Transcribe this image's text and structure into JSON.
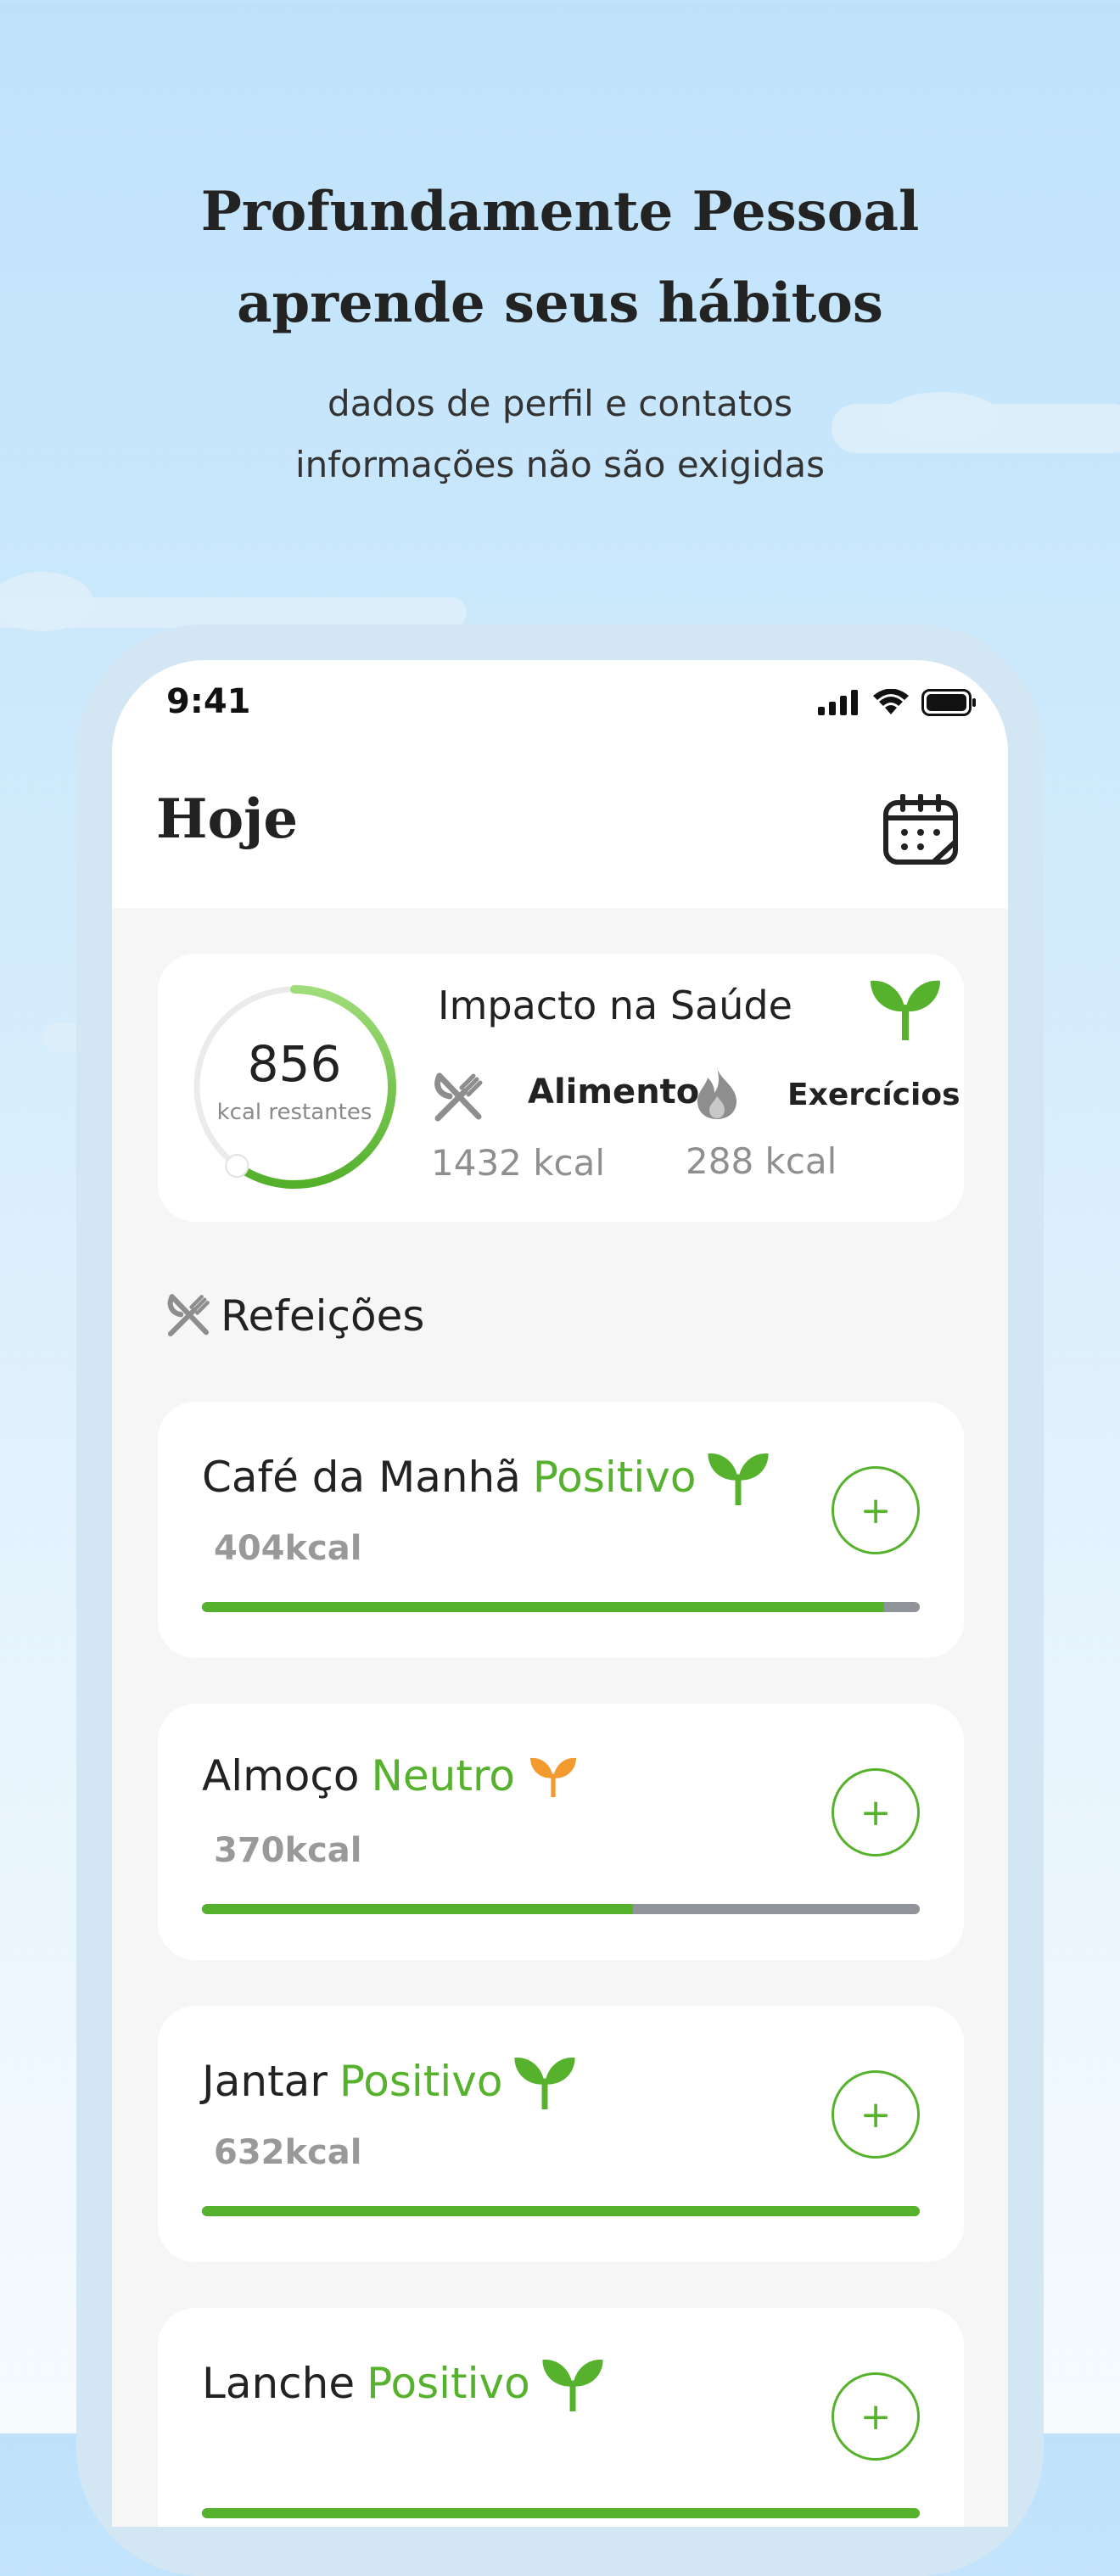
{
  "hero": {
    "title_line1": "Profundamente Pessoal",
    "title_line2": "aprende seus hábitos",
    "subtitle_line1": "dados de perfil e contatos",
    "subtitle_line2": "informações não são exigidas"
  },
  "status_bar": {
    "time": "9:41",
    "icons": [
      "signal-icon",
      "wifi-icon",
      "battery-icon"
    ]
  },
  "header": {
    "title": "Hoje",
    "calendar_icon": "calendar-icon"
  },
  "summary": {
    "remaining_value": "856",
    "remaining_label": "kcal restantes",
    "ring_progress": 0.6,
    "impact_title": "Impacto na Saúde",
    "impact_icon": "sprout-icon",
    "food_label": "Alimento",
    "food_kcal": "1432 kcal",
    "food_icon": "fork-knife-icon",
    "exercise_label": "Exercícios",
    "exercise_kcal": "288 kcal",
    "exercise_icon": "fire-icon"
  },
  "meals_section": {
    "title": "Refeições",
    "icon": "fork-knife-icon"
  },
  "meals": [
    {
      "name": "Café da Manhã",
      "status": "Positivo",
      "kcal": "404kcal",
      "progress": 0.95,
      "sprout_color": "#56b22d",
      "add_label": "+"
    },
    {
      "name": "Almoço",
      "status": "Neutro",
      "kcal": "370kcal",
      "progress": 0.6,
      "sprout_color": "#f29a2e",
      "add_label": "+"
    },
    {
      "name": "Jantar",
      "status": "Positivo",
      "kcal": "632kcal",
      "progress": 1.0,
      "sprout_color": "#56b22d",
      "add_label": "+"
    },
    {
      "name": "Lanche",
      "status": "Positivo",
      "kcal": "",
      "progress": 1.0,
      "sprout_color": "#56b22d",
      "add_label": "+"
    }
  ],
  "colors": {
    "accent_green": "#56b22d",
    "neutral_orange": "#f29a2e",
    "track_gray": "#909397"
  }
}
